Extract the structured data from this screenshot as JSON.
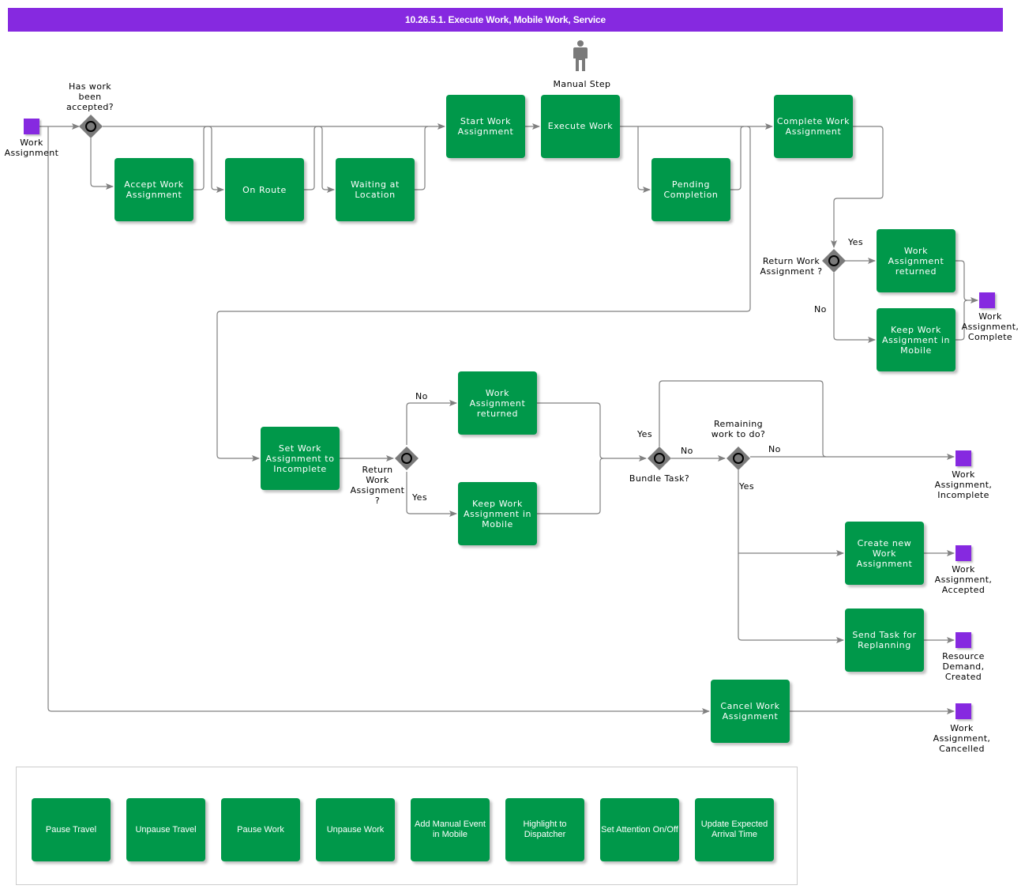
{
  "title": "10.26.5.1. Execute Work, Mobile Work, Service",
  "colors": {
    "header": "#8629e0",
    "task": "#00984a",
    "event": "#8629e0",
    "gateway": "#7a7a7a",
    "connector": "#808080"
  },
  "manual_step": {
    "icon": "person-icon",
    "label": "Manual Step"
  },
  "start_event": {
    "label": "Work\nAssignment"
  },
  "gateways": {
    "accepted": "Has work\nbeen\naccepted?",
    "return_top": "Return Work\nAssignment ?",
    "return_bottom": "Return\nWork\nAssignment\n?",
    "bundle": "Bundle Task?",
    "remaining": "Remaining\nwork to do?"
  },
  "tasks": {
    "accept": "Accept Work Assignment",
    "on_route": "On Route",
    "waiting": "Waiting at Location",
    "start": "Start Work Assignment",
    "execute": "Execute Work",
    "pending": "Pending Completion",
    "complete": "Complete Work Assignment",
    "returned_top": "Work Assignment returned",
    "keep_top": "Keep Work Assignment in Mobile",
    "set_incomplete": "Set Work Assignment to Incomplete",
    "returned_bottom": "Work Assignment returned",
    "keep_bottom": "Keep Work Assignment in Mobile",
    "create_new": "Create new Work Assignment",
    "replanning": "Send Task for Replanning",
    "cancel": "Cancel Work Assignment"
  },
  "end_events": {
    "complete": "Work\nAssignment,\nComplete",
    "incomplete": "Work\nAssignment,\nIncomplete",
    "accepted": "Work\nAssignment,\nAccepted",
    "resource_demand": "Resource\nDemand,\nCreated",
    "cancelled": "Work\nAssignment,\nCancelled"
  },
  "flow_labels": {
    "yes": "Yes",
    "no": "No"
  },
  "legend_tasks": [
    "Pause Travel",
    "Unpause Travel",
    "Pause Work",
    "Unpause Work",
    "Add Manual Event in Mobile",
    "Highlight to Dispatcher",
    "Set Attention On/Off",
    "Update Expected Arrival Time"
  ]
}
